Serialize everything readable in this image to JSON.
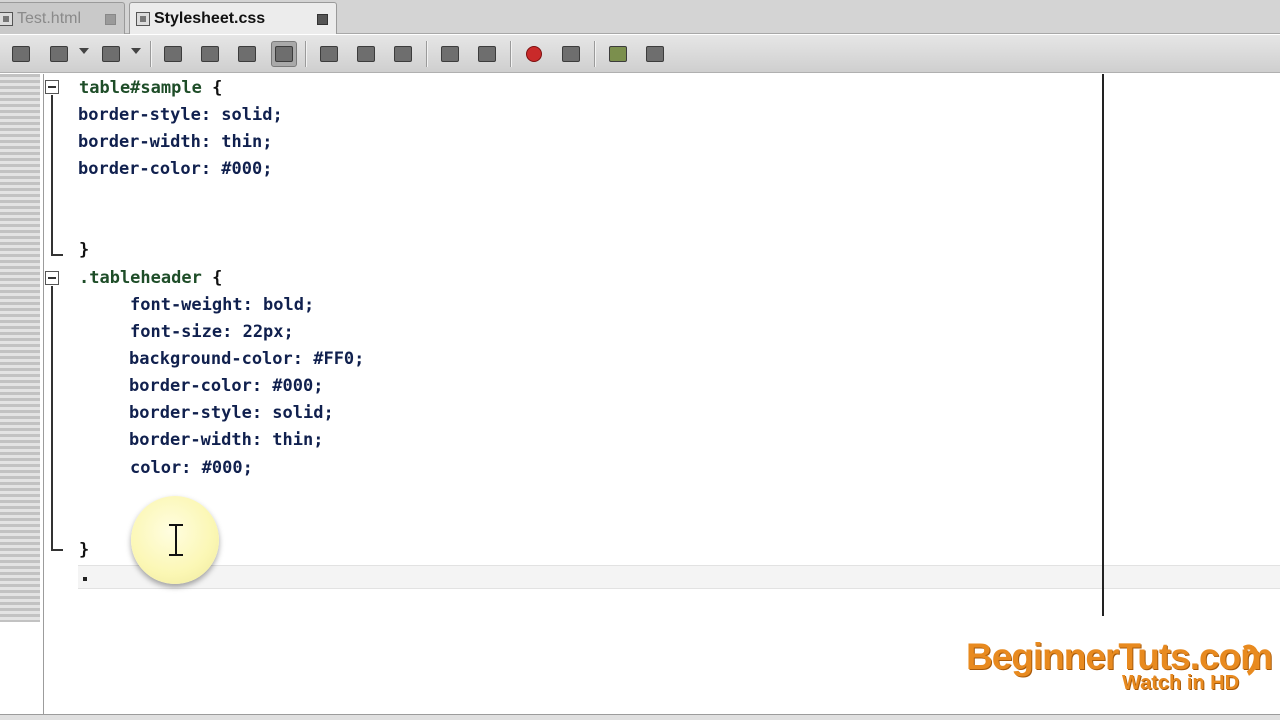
{
  "tabs": [
    {
      "label": "Test.html",
      "active": false
    },
    {
      "label": "Stylesheet.css",
      "active": true
    }
  ],
  "toolbar": {
    "buttons": [
      "open-file-icon",
      "save-icon",
      "dropdown-icon",
      "save-all-icon",
      "dropdown-icon",
      "find-icon",
      "find-previous-icon",
      "find-next-icon",
      "toggle-highlight-icon",
      "previous-bookmark-icon",
      "next-bookmark-icon",
      "toggle-bookmark-icon",
      "shift-left-icon",
      "shift-right-icon",
      "start-macro-recording-icon",
      "stop-macro-recording-icon",
      "comment-icon",
      "uncomment-icon"
    ]
  },
  "code": {
    "lines": [
      {
        "selector": "table#sample",
        "brace": " {"
      },
      {
        "property": "border-style: solid;"
      },
      {
        "property": "border-width: thin;"
      },
      {
        "property": "border-color: #000;"
      },
      {
        "close": "}"
      },
      {
        "selector": ".tableheader",
        "brace": " {"
      },
      {
        "property": "font-weight: bold;"
      },
      {
        "property": "font-size: 22px;"
      },
      {
        "property": "background-color: #FF0;"
      },
      {
        "property": "border-color: #000;"
      },
      {
        "property": "border-style: solid;"
      },
      {
        "property": "border-width: thin;"
      },
      {
        "property": "color: #000;"
      },
      {
        "close": "}"
      },
      {
        "current": "."
      }
    ]
  },
  "watermark": {
    "title": "BeginnerTuts.com",
    "subtitle": "Watch in HD"
  },
  "colors": {
    "selector": "#1e4d28",
    "property": "#10204e",
    "watermark": "#e88a1f",
    "cursor_highlight": "#fbf7b4"
  }
}
